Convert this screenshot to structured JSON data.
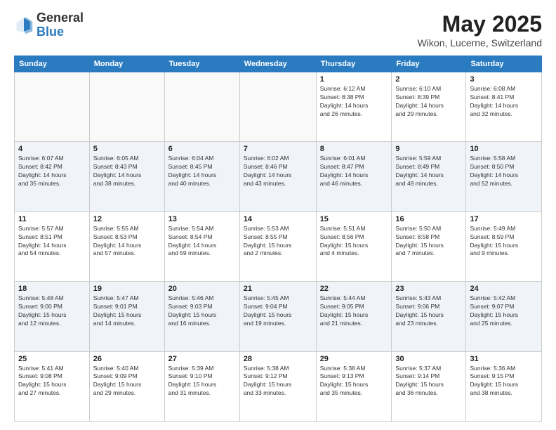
{
  "header": {
    "logo_general": "General",
    "logo_blue": "Blue",
    "title": "May 2025",
    "subtitle": "Wikon, Lucerne, Switzerland"
  },
  "days_of_week": [
    "Sunday",
    "Monday",
    "Tuesday",
    "Wednesday",
    "Thursday",
    "Friday",
    "Saturday"
  ],
  "weeks": [
    [
      {
        "day": "",
        "detail": ""
      },
      {
        "day": "",
        "detail": ""
      },
      {
        "day": "",
        "detail": ""
      },
      {
        "day": "",
        "detail": ""
      },
      {
        "day": "1",
        "detail": "Sunrise: 6:12 AM\nSunset: 8:38 PM\nDaylight: 14 hours\nand 26 minutes."
      },
      {
        "day": "2",
        "detail": "Sunrise: 6:10 AM\nSunset: 8:39 PM\nDaylight: 14 hours\nand 29 minutes."
      },
      {
        "day": "3",
        "detail": "Sunrise: 6:08 AM\nSunset: 8:41 PM\nDaylight: 14 hours\nand 32 minutes."
      }
    ],
    [
      {
        "day": "4",
        "detail": "Sunrise: 6:07 AM\nSunset: 8:42 PM\nDaylight: 14 hours\nand 35 minutes."
      },
      {
        "day": "5",
        "detail": "Sunrise: 6:05 AM\nSunset: 8:43 PM\nDaylight: 14 hours\nand 38 minutes."
      },
      {
        "day": "6",
        "detail": "Sunrise: 6:04 AM\nSunset: 8:45 PM\nDaylight: 14 hours\nand 40 minutes."
      },
      {
        "day": "7",
        "detail": "Sunrise: 6:02 AM\nSunset: 8:46 PM\nDaylight: 14 hours\nand 43 minutes."
      },
      {
        "day": "8",
        "detail": "Sunrise: 6:01 AM\nSunset: 8:47 PM\nDaylight: 14 hours\nand 46 minutes."
      },
      {
        "day": "9",
        "detail": "Sunrise: 5:59 AM\nSunset: 8:49 PM\nDaylight: 14 hours\nand 49 minutes."
      },
      {
        "day": "10",
        "detail": "Sunrise: 5:58 AM\nSunset: 8:50 PM\nDaylight: 14 hours\nand 52 minutes."
      }
    ],
    [
      {
        "day": "11",
        "detail": "Sunrise: 5:57 AM\nSunset: 8:51 PM\nDaylight: 14 hours\nand 54 minutes."
      },
      {
        "day": "12",
        "detail": "Sunrise: 5:55 AM\nSunset: 8:53 PM\nDaylight: 14 hours\nand 57 minutes."
      },
      {
        "day": "13",
        "detail": "Sunrise: 5:54 AM\nSunset: 8:54 PM\nDaylight: 14 hours\nand 59 minutes."
      },
      {
        "day": "14",
        "detail": "Sunrise: 5:53 AM\nSunset: 8:55 PM\nDaylight: 15 hours\nand 2 minutes."
      },
      {
        "day": "15",
        "detail": "Sunrise: 5:51 AM\nSunset: 8:56 PM\nDaylight: 15 hours\nand 4 minutes."
      },
      {
        "day": "16",
        "detail": "Sunrise: 5:50 AM\nSunset: 8:58 PM\nDaylight: 15 hours\nand 7 minutes."
      },
      {
        "day": "17",
        "detail": "Sunrise: 5:49 AM\nSunset: 8:59 PM\nDaylight: 15 hours\nand 9 minutes."
      }
    ],
    [
      {
        "day": "18",
        "detail": "Sunrise: 5:48 AM\nSunset: 9:00 PM\nDaylight: 15 hours\nand 12 minutes."
      },
      {
        "day": "19",
        "detail": "Sunrise: 5:47 AM\nSunset: 9:01 PM\nDaylight: 15 hours\nand 14 minutes."
      },
      {
        "day": "20",
        "detail": "Sunrise: 5:46 AM\nSunset: 9:03 PM\nDaylight: 15 hours\nand 16 minutes."
      },
      {
        "day": "21",
        "detail": "Sunrise: 5:45 AM\nSunset: 9:04 PM\nDaylight: 15 hours\nand 19 minutes."
      },
      {
        "day": "22",
        "detail": "Sunrise: 5:44 AM\nSunset: 9:05 PM\nDaylight: 15 hours\nand 21 minutes."
      },
      {
        "day": "23",
        "detail": "Sunrise: 5:43 AM\nSunset: 9:06 PM\nDaylight: 15 hours\nand 23 minutes."
      },
      {
        "day": "24",
        "detail": "Sunrise: 5:42 AM\nSunset: 9:07 PM\nDaylight: 15 hours\nand 25 minutes."
      }
    ],
    [
      {
        "day": "25",
        "detail": "Sunrise: 5:41 AM\nSunset: 9:08 PM\nDaylight: 15 hours\nand 27 minutes."
      },
      {
        "day": "26",
        "detail": "Sunrise: 5:40 AM\nSunset: 9:09 PM\nDaylight: 15 hours\nand 29 minutes."
      },
      {
        "day": "27",
        "detail": "Sunrise: 5:39 AM\nSunset: 9:10 PM\nDaylight: 15 hours\nand 31 minutes."
      },
      {
        "day": "28",
        "detail": "Sunrise: 5:38 AM\nSunset: 9:12 PM\nDaylight: 15 hours\nand 33 minutes."
      },
      {
        "day": "29",
        "detail": "Sunrise: 5:38 AM\nSunset: 9:13 PM\nDaylight: 15 hours\nand 35 minutes."
      },
      {
        "day": "30",
        "detail": "Sunrise: 5:37 AM\nSunset: 9:14 PM\nDaylight: 15 hours\nand 36 minutes."
      },
      {
        "day": "31",
        "detail": "Sunrise: 5:36 AM\nSunset: 9:15 PM\nDaylight: 15 hours\nand 38 minutes."
      }
    ]
  ]
}
